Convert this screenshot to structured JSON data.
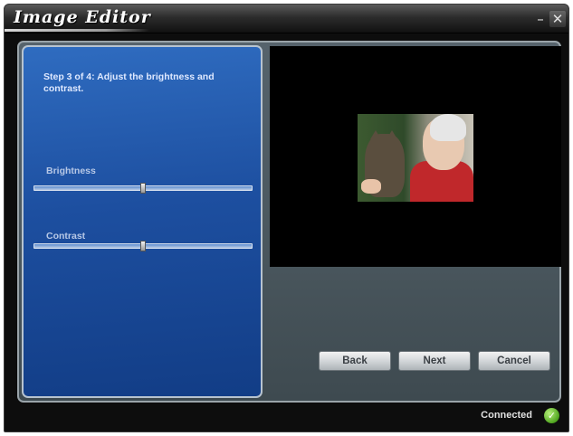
{
  "window": {
    "title": "Image Editor",
    "minimize_glyph": "–",
    "close_glyph": "✕"
  },
  "left_panel": {
    "step_text": "Step 3 of 4: Adjust the brightness and contrast.",
    "brightness": {
      "label": "Brightness",
      "value_fraction": 0.5
    },
    "contrast": {
      "label": "Contrast",
      "value_fraction": 0.5
    }
  },
  "preview": {
    "image_icon": "photo-man-with-cat"
  },
  "buttons": {
    "back": "Back",
    "next": "Next",
    "cancel": "Cancel"
  },
  "status": {
    "text": "Connected",
    "icon": "check-circle-icon",
    "icon_color": "#4fa51f"
  }
}
